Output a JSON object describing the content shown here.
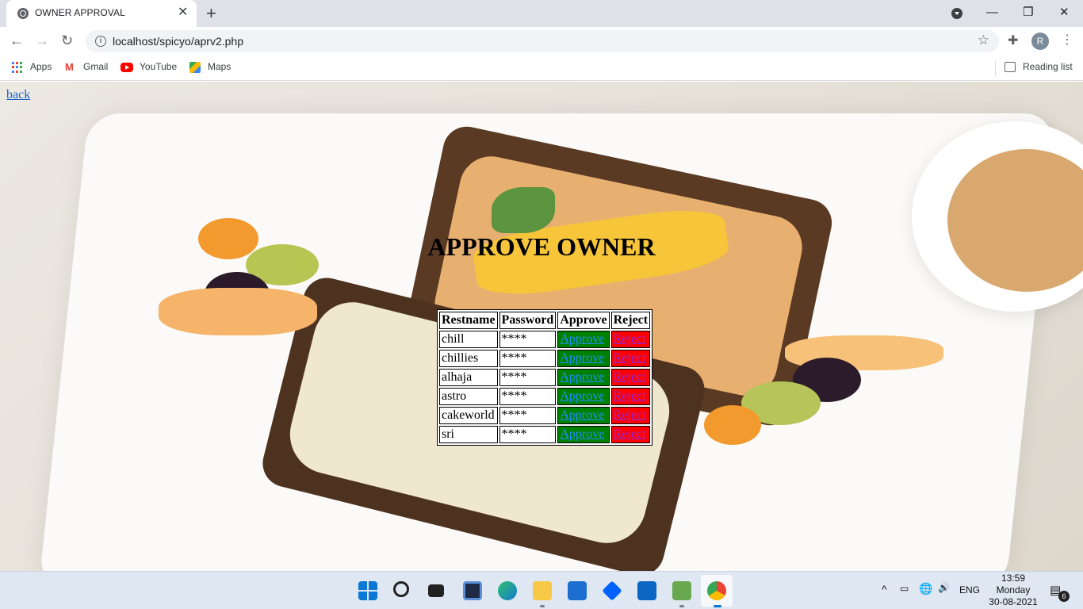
{
  "browser": {
    "tab_title": "OWNER APPROVAL",
    "url": "localhost/spicyo/aprv2.php",
    "profile_initial": "R",
    "bookmarks": [
      {
        "label": "Apps",
        "icon": "apps-grid-icon"
      },
      {
        "label": "Gmail",
        "icon": "gmail-icon"
      },
      {
        "label": "YouTube",
        "icon": "youtube-icon"
      },
      {
        "label": "Maps",
        "icon": "maps-icon"
      }
    ],
    "reading_list": "Reading list"
  },
  "page": {
    "back_link": "back",
    "heading": "APPROVE OWNER",
    "table": {
      "headers": [
        "Restname",
        "Password",
        "Approve",
        "Reject"
      ],
      "rows": [
        {
          "restname": "chill",
          "password": "****",
          "approve": "Approve",
          "reject": "Reject"
        },
        {
          "restname": "chillies",
          "password": "****",
          "approve": "Approve",
          "reject": "Reject"
        },
        {
          "restname": "alhaja",
          "password": "****",
          "approve": "Approve",
          "reject": "Reject"
        },
        {
          "restname": "astro",
          "password": "****",
          "approve": "Approve",
          "reject": "Reject"
        },
        {
          "restname": "cakeworld",
          "password": "****",
          "approve": "Approve",
          "reject": "Reject"
        },
        {
          "restname": "sri",
          "password": "****",
          "approve": "Approve",
          "reject": "Reject"
        }
      ]
    },
    "colors": {
      "approve_bg": "#008000",
      "reject_bg": "#ff0000",
      "link_blue": "#1a62c8"
    }
  },
  "taskbar": {
    "language": "ENG",
    "time": "13:59",
    "day": "Monday",
    "date": "30-08-2021",
    "notification_count": "6"
  }
}
